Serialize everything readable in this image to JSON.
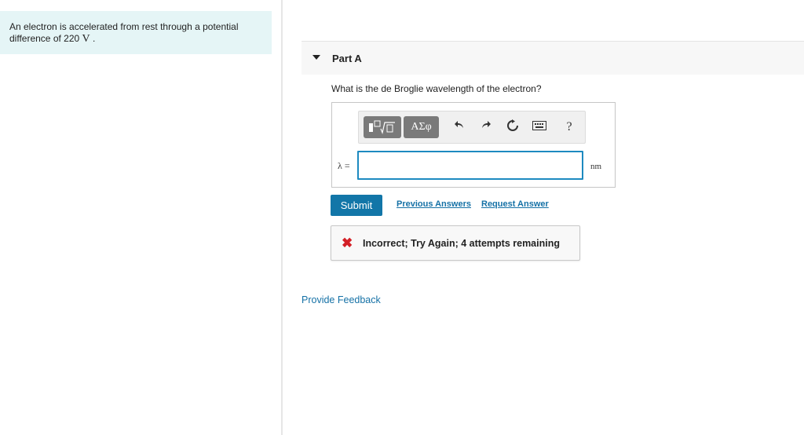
{
  "problem": {
    "text": "An electron is accelerated from rest through a potential difference of 220",
    "unit_symbol": "V",
    "end": "."
  },
  "part": {
    "title": "Part A",
    "question": "What is the de Broglie wavelength of the electron?"
  },
  "toolbar": {
    "greek_label": "ΑΣφ",
    "help_label": "?"
  },
  "answer": {
    "variable_label": "λ =",
    "value": "",
    "unit": "nm"
  },
  "actions": {
    "submit_label": "Submit",
    "previous_answers_label": "Previous Answers",
    "request_answer_label": "Request Answer"
  },
  "feedback": {
    "message": "Incorrect; Try Again; 4 attempts remaining"
  },
  "footer": {
    "provide_feedback_label": "Provide Feedback"
  },
  "colors": {
    "accent": "#1276a8",
    "link": "#1571a6",
    "error": "#d31f26",
    "problem_bg": "#e5f5f6"
  }
}
